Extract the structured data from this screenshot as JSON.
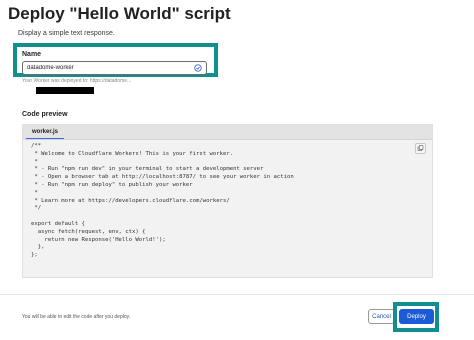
{
  "header": {
    "title": "Deploy \"Hello World\" script",
    "subtitle": "Display a simple text response."
  },
  "name_field": {
    "label": "Name",
    "value": "datadome-worker",
    "status_icon": "check-circle-icon",
    "help_text": "Your Worker was deployed to: https://datadome..."
  },
  "code_preview": {
    "label": "Code preview",
    "tab": "worker.js",
    "copy_icon": "copy-icon",
    "code": "/**\n * Welcome to Cloudflare Workers! This is your first worker.\n *\n * - Run \"npm run dev\" in your terminal to start a development server\n * - Open a browser tab at http://localhost:8787/ to see your worker in action\n * - Run \"npm run deploy\" to publish your worker\n *\n * Learn more at https://developers.cloudflare.com/workers/\n */\n\nexport default {\n  async fetch(request, env, ctx) {\n    return new Response('Hello World!');\n  },\n};"
  },
  "footer": {
    "note": "You will be able to edit the code after you deploy.",
    "cancel_label": "Cancel",
    "deploy_label": "Deploy"
  },
  "colors": {
    "highlight_frame": "#0f8f8f",
    "primary_button": "#1c5bd8",
    "link_text": "#2a56c6"
  }
}
